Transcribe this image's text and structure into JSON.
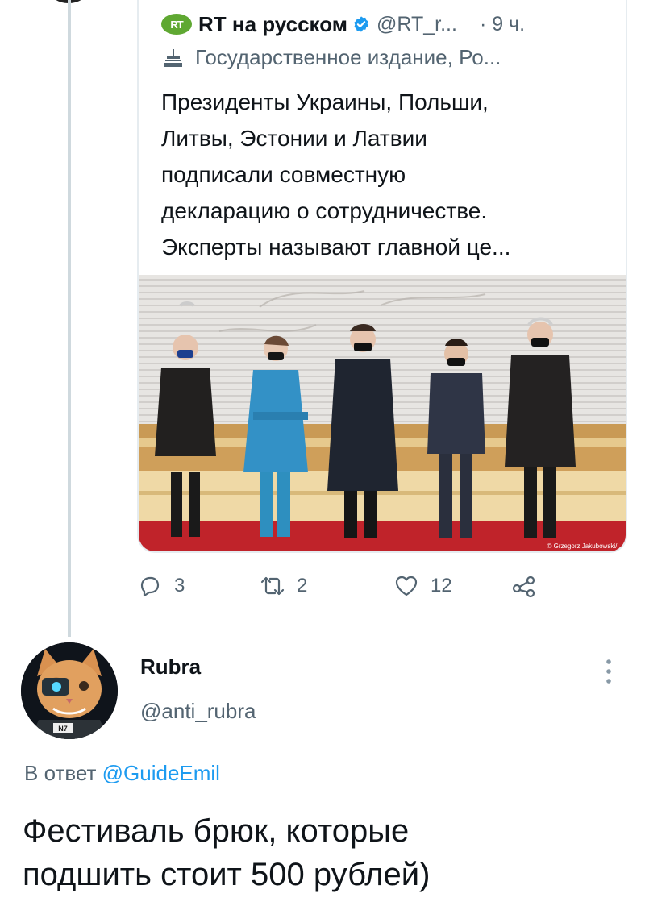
{
  "quoted_tweet": {
    "author_name": "RT на русском",
    "logo_text": "RT",
    "handle": "@RT_r...",
    "time": "· 9 ч.",
    "label": "Государственное издание, Ро...",
    "text_lines": [
      "Президенты Украины, Польши,",
      "Литвы, Эстонии и Латвии",
      "подписали совместную",
      "декларацию о сотрудничестве.",
      "Эксперты называют главной це..."
    ],
    "photo_credit": "© Grzegorz Jakubowski/..."
  },
  "actions": {
    "replies": "3",
    "retweets": "2",
    "likes": "12"
  },
  "reply": {
    "author_name": "Rubra",
    "handle": "@anti_rubra",
    "avatar_badge": "N7",
    "reply_to_prefix": "В ответ",
    "reply_to_handle": "@GuideEmil",
    "text_lines": [
      "Фестиваль брюк, которые",
      "подшить стоит 500 рублей)"
    ]
  },
  "colors": {
    "accent": "#1d9bf0",
    "rt_green": "#5fa832",
    "muted": "#536471"
  }
}
